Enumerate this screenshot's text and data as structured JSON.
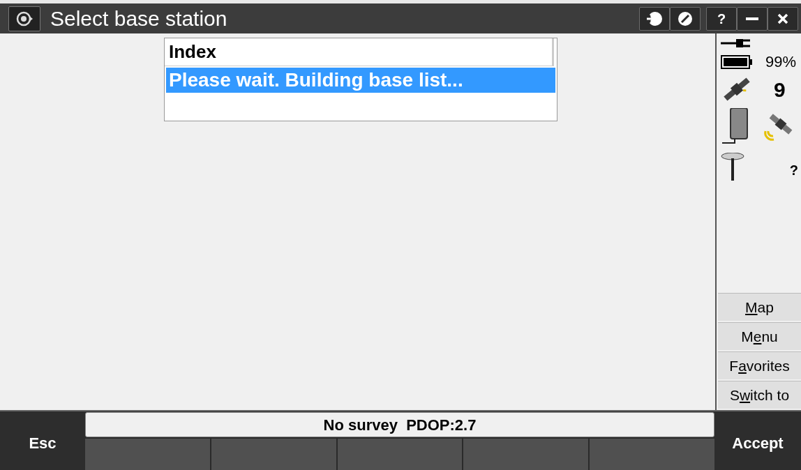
{
  "window": {
    "title": "Select base station",
    "title_buttons": [
      {
        "kind": "login"
      },
      {
        "kind": "cancel"
      },
      {
        "label": "?",
        "kind": "help"
      },
      {
        "kind": "minimize"
      },
      {
        "kind": "close"
      }
    ]
  },
  "list": {
    "column": "Index",
    "rows": [
      {
        "text": "Please wait. Building base list...",
        "selected": true
      }
    ]
  },
  "status_panel": {
    "battery": "99%",
    "satellites": "9",
    "rover": "?"
  },
  "side_buttons": [
    {
      "key": "M",
      "after": "ap"
    },
    {
      "before": "M",
      "key": "e",
      "after": "nu"
    },
    {
      "before": "F",
      "key": "a",
      "after": "vorites"
    },
    {
      "before": "S",
      "key": "w",
      "after": "itch to"
    }
  ],
  "status_bar": "No survey  PDOP:2.7",
  "softkeys": {
    "left": "Esc",
    "right": "Accept"
  }
}
